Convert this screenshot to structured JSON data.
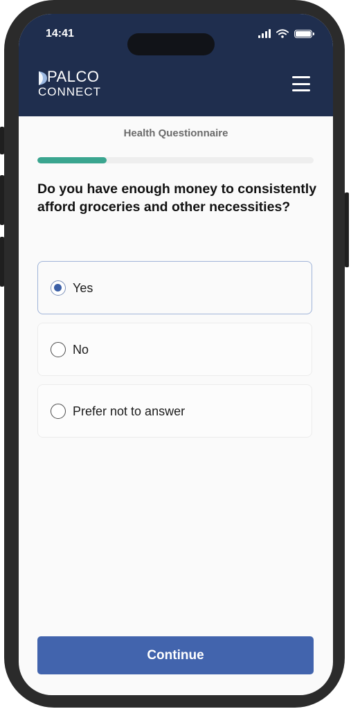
{
  "status_bar": {
    "time": "14:41"
  },
  "header": {
    "logo_line1": "PALCO",
    "logo_line2": "CONNECT",
    "icons": [
      "logo-mark-icon",
      "hamburger-menu-icon",
      "signal-icon",
      "wifi-icon",
      "battery-icon"
    ]
  },
  "page": {
    "title": "Health Questionnaire",
    "progress_fraction": 0.25,
    "question": "Do you have enough money to consistently afford groceries and other necessities?"
  },
  "options": [
    {
      "label": "Yes",
      "selected": true
    },
    {
      "label": "No",
      "selected": false
    },
    {
      "label": "Prefer not to answer",
      "selected": false
    }
  ],
  "footer": {
    "continue_label": "Continue"
  },
  "colors": {
    "header_bg": "#1f2e4e",
    "progress_fill": "#3aa58f",
    "accent_button": "#4264ad",
    "radio_selected": "#3b5fa6",
    "selected_border": "#9fb3d8"
  }
}
